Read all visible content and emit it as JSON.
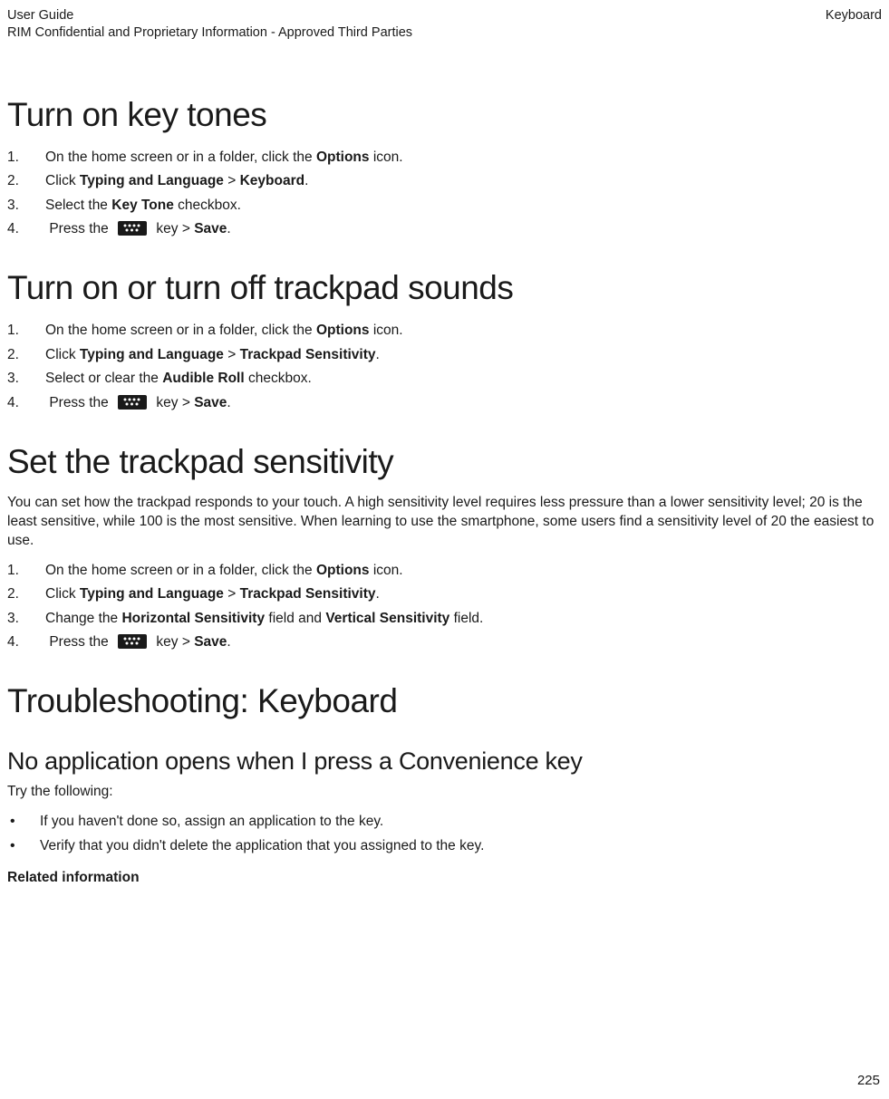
{
  "header": {
    "left1": "User Guide",
    "left2": "RIM Confidential and Proprietary Information - Approved Third Parties",
    "right": "Keyboard"
  },
  "s1": {
    "title": "Turn on key tones",
    "li1a": "On the home screen or in a folder, click the ",
    "li1b": "Options",
    "li1c": " icon.",
    "li2a": "Click ",
    "li2b": "Typing and Language",
    "li2c": " > ",
    "li2d": "Keyboard",
    "li2e": ".",
    "li3a": "Select the ",
    "li3b": "Key Tone",
    "li3c": " checkbox.",
    "li4a": "Press the ",
    "li4b": " key > ",
    "li4c": "Save",
    "li4d": "."
  },
  "s2": {
    "title": "Turn on or turn off trackpad sounds",
    "li1a": "On the home screen or in a folder, click the ",
    "li1b": "Options",
    "li1c": " icon.",
    "li2a": "Click ",
    "li2b": "Typing and Language",
    "li2c": " > ",
    "li2d": "Trackpad Sensitivity",
    "li2e": ".",
    "li3a": "Select or clear the ",
    "li3b": "Audible Roll",
    "li3c": " checkbox.",
    "li4a": "Press the ",
    "li4b": " key > ",
    "li4c": "Save",
    "li4d": "."
  },
  "s3": {
    "title": "Set the trackpad sensitivity",
    "para": "You can set how the trackpad responds to your touch. A high sensitivity level requires less pressure than a lower sensitivity level; 20 is the least sensitive, while 100 is the most sensitive. When learning to use the smartphone, some users find a sensitivity level of 20 the easiest to use.",
    "li1a": "On the home screen or in a folder, click the ",
    "li1b": "Options",
    "li1c": " icon.",
    "li2a": "Click ",
    "li2b": "Typing and Language",
    "li2c": " > ",
    "li2d": "Trackpad Sensitivity",
    "li2e": ".",
    "li3a": "Change the ",
    "li3b": "Horizontal Sensitivity",
    "li3c": " field and ",
    "li3d": "Vertical Sensitivity",
    "li3e": " field.",
    "li4a": "Press the ",
    "li4b": " key > ",
    "li4c": "Save",
    "li4d": "."
  },
  "s4": {
    "title": "Troubleshooting: Keyboard",
    "sub": "No application opens when I press a Convenience key",
    "try": "Try the following:",
    "b1": "If you haven't done so, assign an application to the key.",
    "b2": "Verify that you didn't delete the application that you assigned to the key.",
    "related": "Related information"
  },
  "page": "225"
}
